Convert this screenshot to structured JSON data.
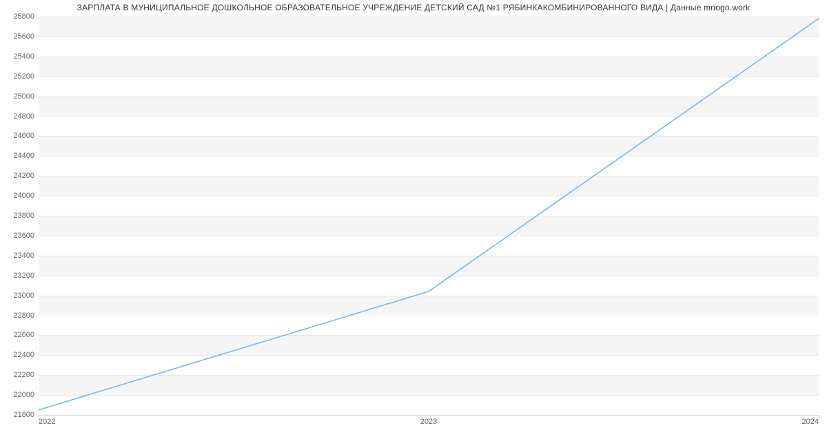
{
  "chart_data": {
    "type": "line",
    "title": "ЗАРПЛАТА В МУНИЦИПАЛЬНОЕ ДОШКОЛЬНОЕ ОБРАЗОВАТЕЛЬНОЕ УЧРЕЖДЕНИЕ ДЕТСКИЙ САД №1 РЯБИНКАКОМБИНИРОВАННОГО ВИДА | Данные mnogo.work",
    "x": [
      2022,
      2023,
      2024
    ],
    "values": [
      21850,
      23040,
      25780
    ],
    "x_tick_labels": [
      "2022",
      "2023",
      "2024"
    ],
    "y_ticks": [
      21800,
      22000,
      22200,
      22400,
      22600,
      22800,
      23000,
      23200,
      23400,
      23600,
      23800,
      24000,
      24200,
      24400,
      24600,
      24800,
      25000,
      25200,
      25400,
      25600,
      25800
    ],
    "xlim": [
      2022,
      2024
    ],
    "ylim": [
      21800,
      25800
    ],
    "xlabel": "",
    "ylabel": "",
    "grid": true,
    "line_color": "#7cb5ec"
  }
}
